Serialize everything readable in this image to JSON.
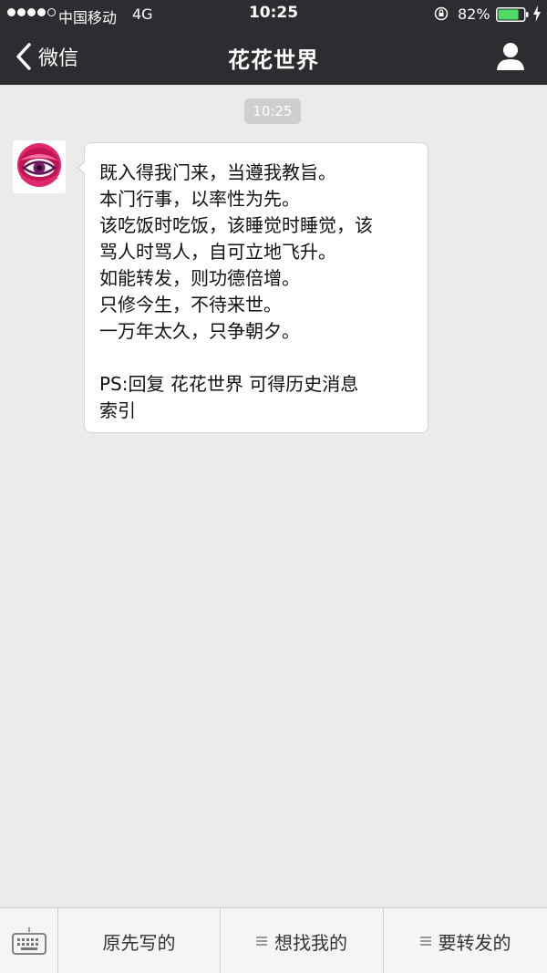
{
  "status_bar": {
    "carrier": "中国移动",
    "network": "4G",
    "time": "10:25",
    "battery_percent": "82%",
    "battery_level": 0.82,
    "signal_strength": 4
  },
  "nav": {
    "back_label": "微信",
    "title": "花花世界"
  },
  "chat": {
    "timestamp": "10:25",
    "message_lines": [
      "既入得我门来，当遵我教旨。",
      "本门行事，以率性为先。",
      "该吃饭时吃饭，该睡觉时睡觉，该",
      "骂人时骂人，自可立地飞升。",
      "如能转发，则功德倍增。",
      "只修今生，不待来世。",
      "一万年太久，只争朝夕。",
      "",
      "PS:回复 花花世界 可得历史消息",
      "索引"
    ]
  },
  "menu": {
    "items": [
      {
        "label": "原先写的"
      },
      {
        "label": "想找我的"
      },
      {
        "label": "要转发的"
      }
    ]
  },
  "colors": {
    "nav_bg": "#2d2d31",
    "chat_bg": "#ebebeb",
    "battery_green": "#4cd964"
  }
}
